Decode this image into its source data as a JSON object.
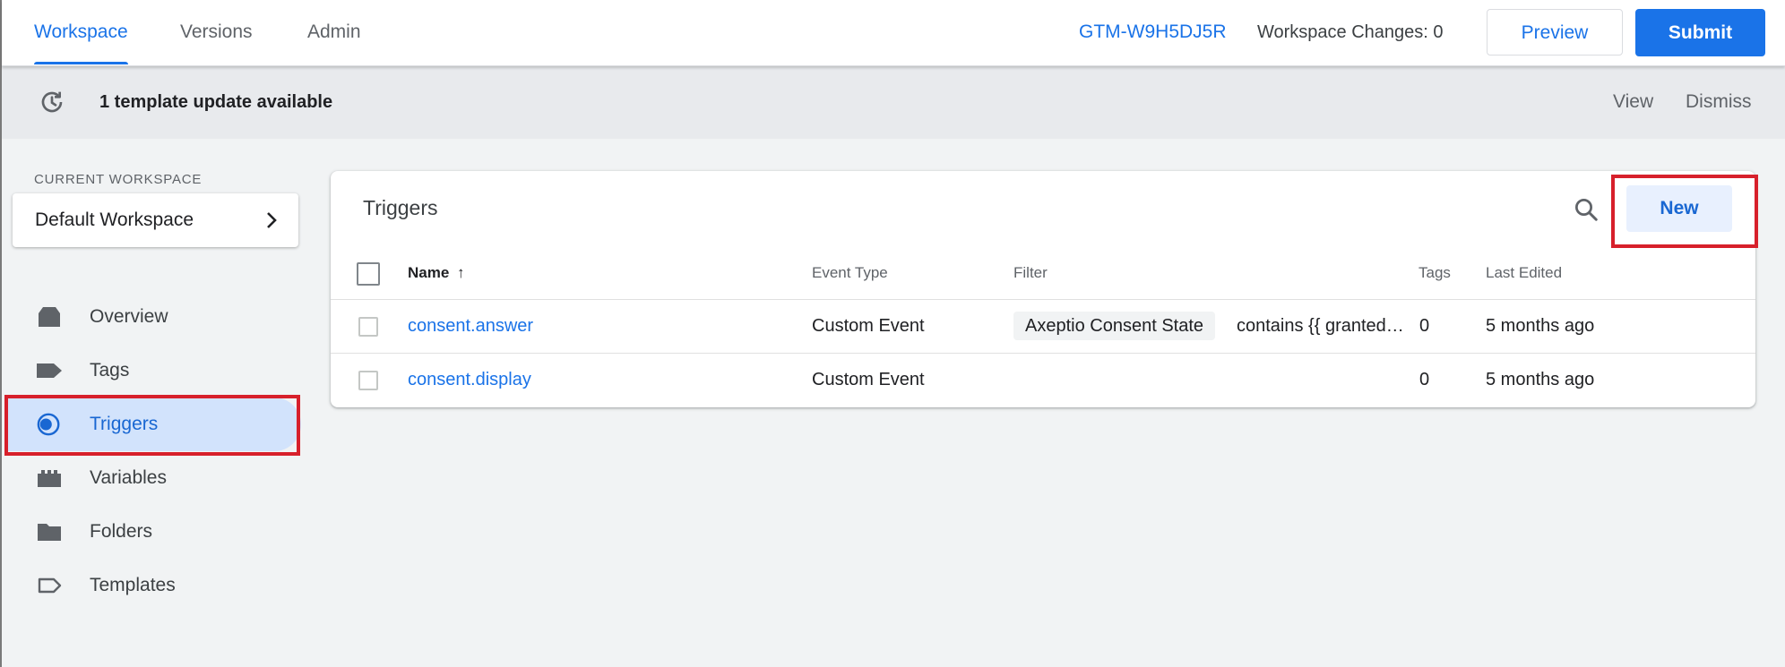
{
  "header": {
    "tabs": [
      {
        "label": "Workspace",
        "active": true
      },
      {
        "label": "Versions",
        "active": false
      },
      {
        "label": "Admin",
        "active": false
      }
    ],
    "container_id": "GTM-W9H5DJ5R",
    "workspace_changes": "Workspace Changes: 0",
    "preview_label": "Preview",
    "submit_label": "Submit"
  },
  "banner": {
    "icon": "refresh-icon",
    "message": "1 template update available",
    "view_label": "View",
    "dismiss_label": "Dismiss"
  },
  "sidebar": {
    "current_workspace_label": "CURRENT WORKSPACE",
    "workspace_name": "Default Workspace",
    "items": [
      {
        "label": "Overview",
        "icon": "overview-icon",
        "active": false
      },
      {
        "label": "Tags",
        "icon": "tag-icon",
        "active": false
      },
      {
        "label": "Triggers",
        "icon": "triggers-icon",
        "active": true
      },
      {
        "label": "Variables",
        "icon": "variables-icon",
        "active": false
      },
      {
        "label": "Folders",
        "icon": "folder-icon",
        "active": false
      },
      {
        "label": "Templates",
        "icon": "templates-icon",
        "active": false
      }
    ]
  },
  "main": {
    "title": "Triggers",
    "new_label": "New",
    "columns": {
      "name": "Name",
      "sort_arrow": "↑",
      "event_type": "Event Type",
      "filter": "Filter",
      "tags": "Tags",
      "last_edited": "Last Edited"
    },
    "rows": [
      {
        "name": "consent.answer",
        "event_type": "Custom Event",
        "filter_variable": "Axeptio Consent State",
        "filter_condition": "contains {{ granted…",
        "tags": "0",
        "last_edited": "5 months ago"
      },
      {
        "name": "consent.display",
        "event_type": "Custom Event",
        "filter_variable": "",
        "filter_condition": "",
        "tags": "0",
        "last_edited": "5 months ago"
      }
    ]
  },
  "colors": {
    "accent": "#1a73e8",
    "highlight": "#d7202b",
    "active_nav_bg": "#d2e3fc"
  }
}
